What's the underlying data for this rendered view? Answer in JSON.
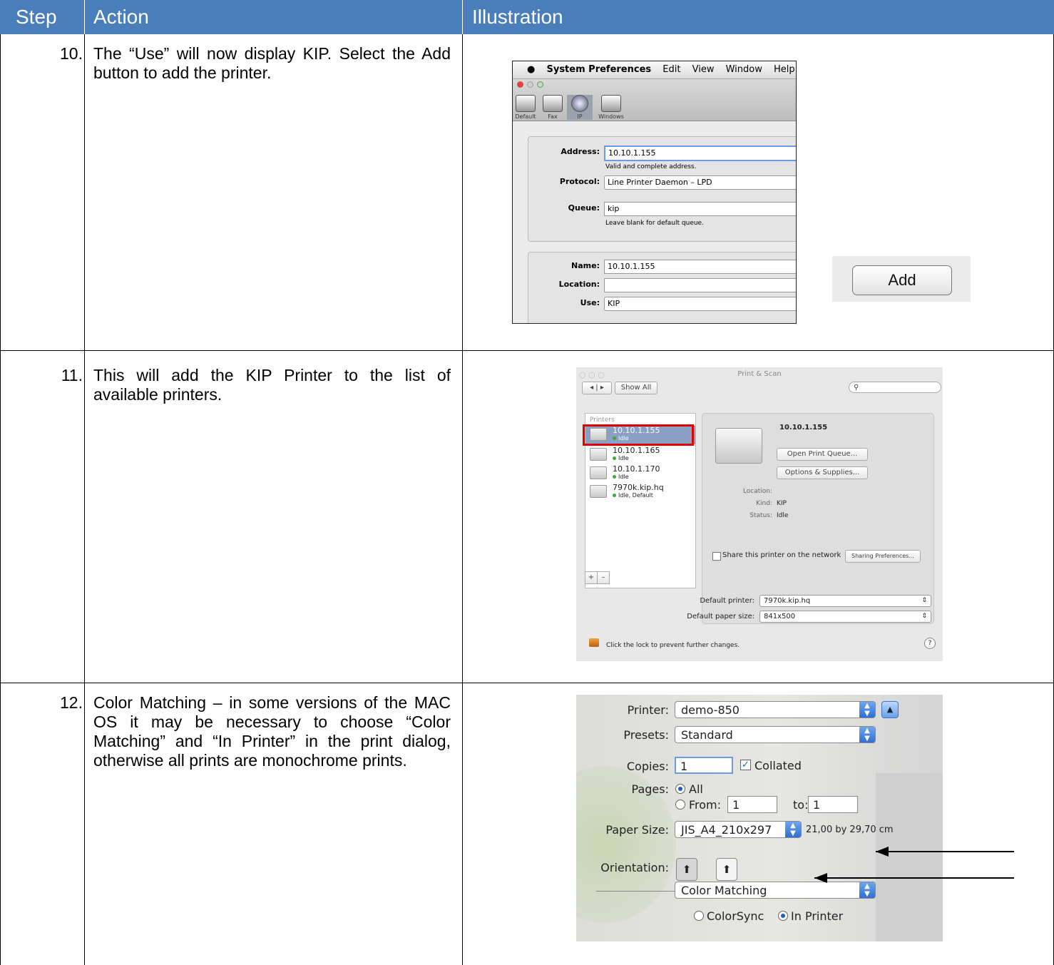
{
  "header": {
    "step": "Step",
    "action": "Action",
    "illustration": "Illustration"
  },
  "rows": [
    {
      "step": "10.",
      "action": "The “Use” will now display KIP. Select the Add button to add the printer."
    },
    {
      "step": "11.",
      "action": "This will add the KIP Printer to the list of available printers."
    },
    {
      "step": "12.",
      "action": "Color Matching – in some versions of the MAC OS it may be necessary to choose “Color Matching” and “In Printer” in the print dialog, otherwise all prints are monochrome prints."
    }
  ],
  "shot1": {
    "menu": [
      "System Preferences",
      "Edit",
      "View",
      "Window",
      "Help"
    ],
    "toolbar": [
      "Default",
      "Fax",
      "IP",
      "Windows"
    ],
    "address_label": "Address:",
    "address": "10.10.1.155",
    "address_hint": "Valid and complete address.",
    "protocol_label": "Protocol:",
    "protocol": "Line Printer Daemon – LPD",
    "queue_label": "Queue:",
    "queue": "kip",
    "queue_hint": "Leave blank for default queue.",
    "name_label": "Name:",
    "name": "10.10.1.155",
    "location_label": "Location:",
    "location": "",
    "use_label": "Use:",
    "use": "KIP",
    "add_button": "Add"
  },
  "shot2": {
    "title": "Print & Scan",
    "show_all": "Show All",
    "printers_header": "Printers",
    "printers": [
      {
        "name": "10.10.1.155",
        "status": "Idle"
      },
      {
        "name": "10.10.1.165",
        "status": "Idle"
      },
      {
        "name": "10.10.1.170",
        "status": "Idle"
      },
      {
        "name": "7970k.kip.hq",
        "status": "Idle, Default"
      }
    ],
    "selected_name": "10.10.1.155",
    "open_queue": "Open Print Queue...",
    "options_supplies": "Options & Supplies...",
    "location_label": "Location:",
    "kind_label": "Kind:",
    "kind": "KIP",
    "status_label": "Status:",
    "status": "Idle",
    "share_label": "Share this printer on the network",
    "sharing_prefs": "Sharing Preferences...",
    "add": "+",
    "remove": "–",
    "default_printer_label": "Default printer:",
    "default_printer": "7970k.kip.hq",
    "default_paper_label": "Default paper size:",
    "default_paper": "841x500",
    "lock_text": "Click the lock to prevent further changes.",
    "help": "?"
  },
  "shot3": {
    "printer_label": "Printer:",
    "printer": "demo-850",
    "presets_label": "Presets:",
    "presets": "Standard",
    "copies_label": "Copies:",
    "copies": "1",
    "collated": "Collated",
    "pages_label": "Pages:",
    "all": "All",
    "from": "From:",
    "from_value": "1",
    "to": "to:",
    "to_value": "1",
    "paper_label": "Paper Size:",
    "paper": "JIS_A4_210x297",
    "paper_dims": "21,00 by 29,70 cm",
    "orientation_label": "Orientation:",
    "section": "Color Matching",
    "colorsync": "ColorSync",
    "in_printer": "In Printer"
  }
}
